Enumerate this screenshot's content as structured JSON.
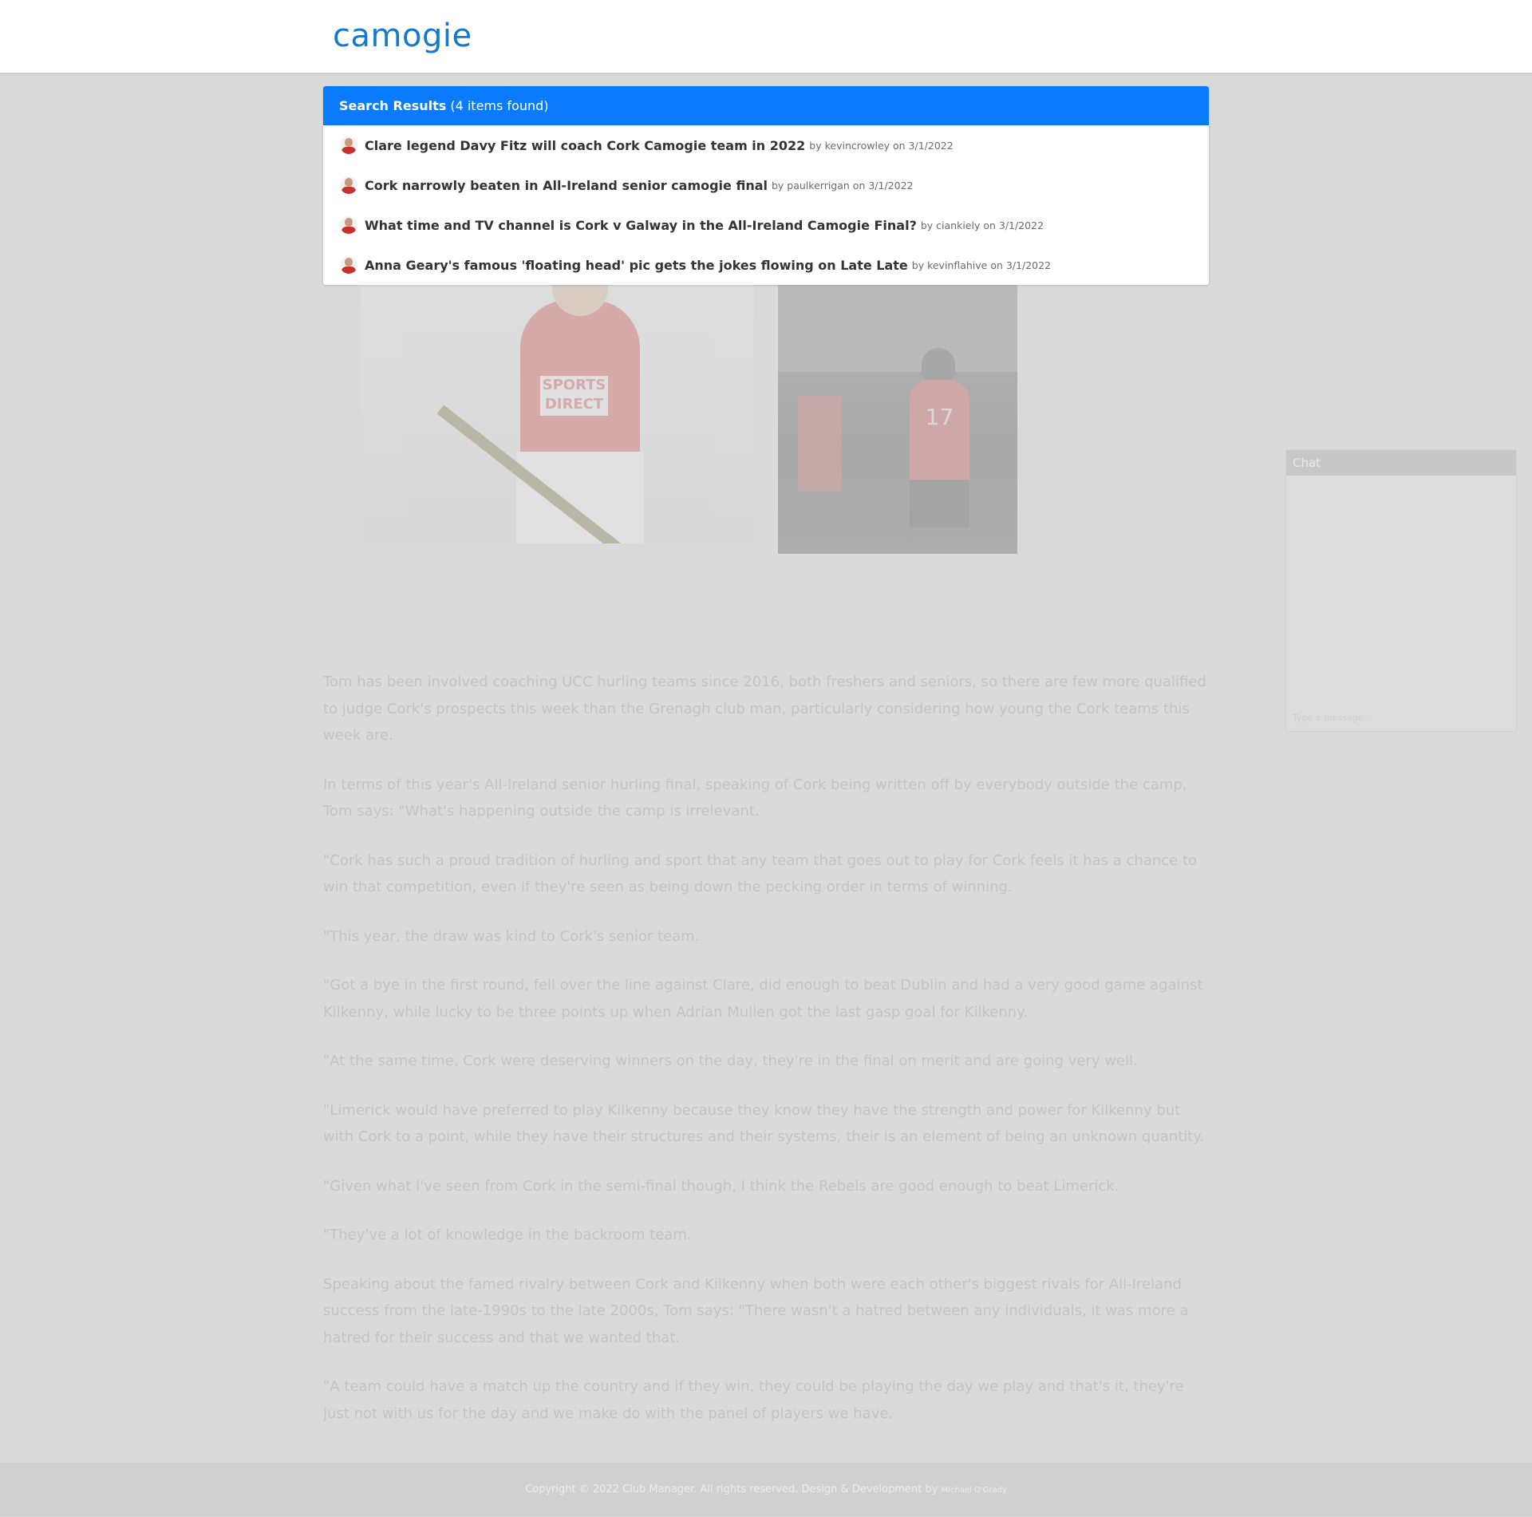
{
  "site": {
    "logo": "camogie"
  },
  "search": {
    "heading_bold": "Search Results",
    "heading_count": "(4 items found)",
    "results": [
      {
        "title": "Clare legend Davy Fitz will coach Cork Camogie team in 2022",
        "meta": "by kevincrowley on 3/1/2022"
      },
      {
        "title": "Cork narrowly beaten in All-Ireland senior camogie final",
        "meta": "by paulkerrigan on 3/1/2022"
      },
      {
        "title": "What time and TV channel is Cork v Galway in the All-Ireland Camogie Final?",
        "meta": "by ciankiely on 3/1/2022"
      },
      {
        "title": "Anna Geary's famous 'floating head' pic gets the jokes flowing on Late Late",
        "meta": "by kevinflahive on 3/1/2022"
      }
    ]
  },
  "article": {
    "image1_sponsor": "SPORTS DIRECT",
    "image2_number": "17",
    "paragraphs": [
      "Tom has been involved coaching UCC hurling teams since 2016, both freshers and seniors, so there are few more qualified to judge Cork's prospects this week than the Grenagh club man, particularly considering how young the Cork teams this week are.",
      "In terms of this year's All-Ireland senior hurling final, speaking of Cork being written off by everybody outside the camp, Tom says: \"What's happening outside the camp is irrelevant.",
      "\"Cork has such a proud tradition of hurling and sport that any team that goes out to play for Cork feels it has a chance to win that competition, even if they're seen as being down the pecking order in terms of winning.",
      "\"This year, the draw was kind to Cork's senior team.",
      "\"Got a bye in the first round, fell over the line against Clare, did enough to beat Dublin and had a very good game against Kilkenny, while lucky to be three points up when Adrian Mullen got the last gasp goal for Kilkenny.",
      "\"At the same time, Cork were deserving winners on the day, they're in the final on merit and are going very well.",
      "\"Limerick would have preferred to play Kilkenny because they know they have the strength and power for Kilkenny but with Cork to a point, while they have their structures and their systems, their is an element of being an unknown quantity.",
      "\"Given what I've seen from Cork in the semi-final though, I think the Rebels are good enough to beat Limerick.",
      "\"They've a lot of knowledge in the backroom team.",
      "Speaking about the famed rivalry between Cork and Kilkenny when both were each other's biggest rivals for All-Ireland success from the late-1990s to the late 2000s, Tom says: \"There wasn't a hatred between any individuals, it was more a hatred for their success and that we wanted that.",
      "\"A team could have a match up the country and if they win, they could be playing the day we play and that's it, they're just not with us for the day and we make do with the panel of players we have."
    ]
  },
  "chat": {
    "title": "Chat",
    "placeholder": "Type a message..."
  },
  "footer": {
    "text": "Copyright © 2022 Club Manager. All rights reserved. Design & Development by",
    "author": "Michael O'Grady"
  },
  "colors": {
    "brand": "#1479cf",
    "results_header": "#0a7bff",
    "overlay_bg": "#dadada"
  }
}
